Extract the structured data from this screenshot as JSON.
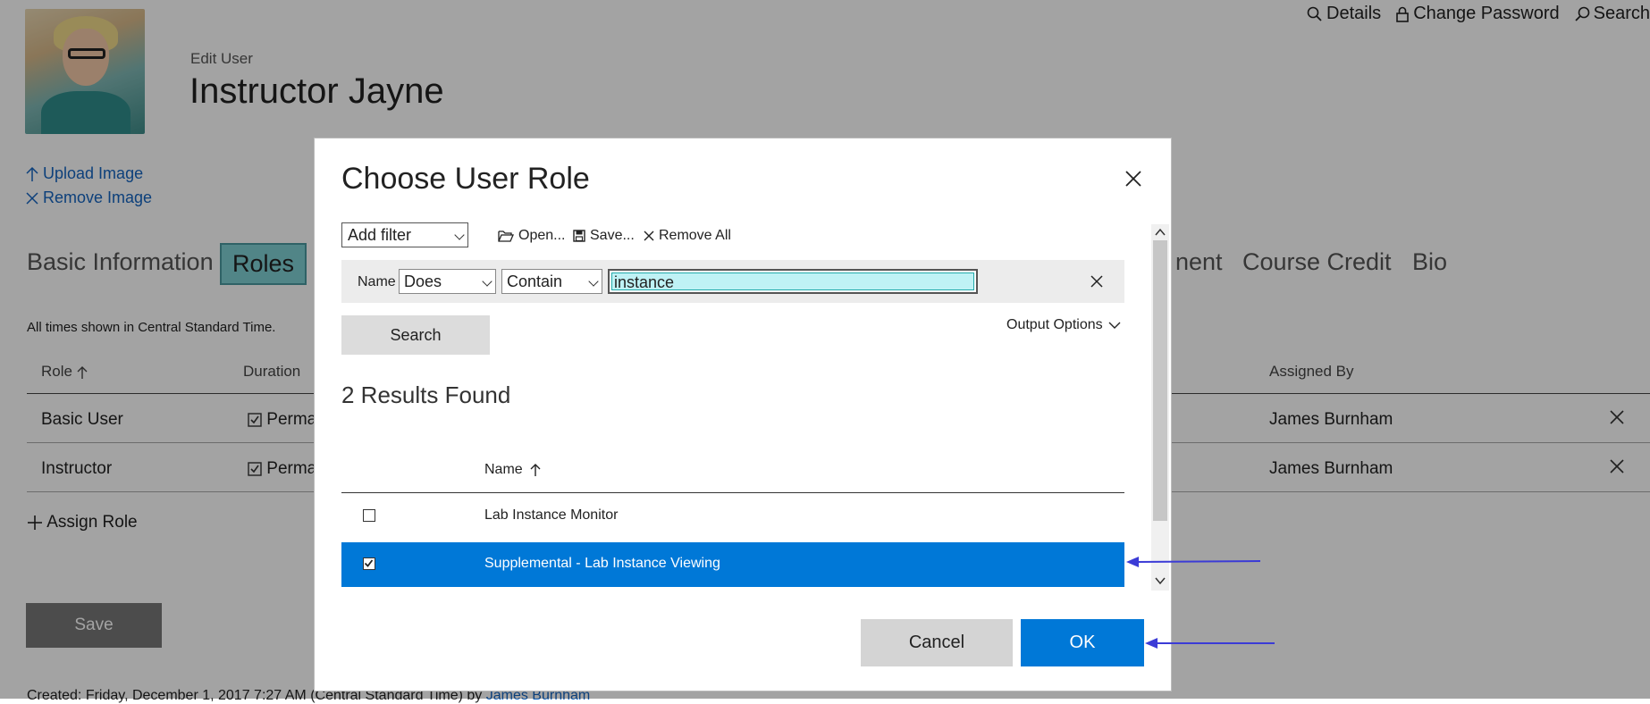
{
  "topnav": {
    "details": "Details",
    "change_password": "Change Password",
    "search": "Search"
  },
  "header": {
    "edit_label": "Edit User",
    "user_name": "Instructor Jayne"
  },
  "image_links": {
    "upload": "Upload Image",
    "remove": "Remove Image"
  },
  "tabs": [
    {
      "label": "Basic Information"
    },
    {
      "label": "Roles"
    },
    {
      "label": "nent"
    },
    {
      "label": "Course Credit"
    },
    {
      "label": "Bio"
    }
  ],
  "timezone_note": "All times shown in Central Standard Time.",
  "roles_table": {
    "headers": {
      "role": "Role",
      "duration": "Duration",
      "assigned_by": "Assigned By"
    },
    "rows": [
      {
        "role": "Basic User",
        "duration": "Perma",
        "assigned_by": "James Burnham"
      },
      {
        "role": "Instructor",
        "duration": "Perma",
        "assigned_by": "James Burnham"
      }
    ]
  },
  "assign_role": "Assign Role",
  "save_label": "Save",
  "created": {
    "prefix": "Created:   Friday, December 1, 2017 7:27 AM (Central Standard Time) by ",
    "by": "James Burnham"
  },
  "dialog": {
    "title": "Choose User Role",
    "add_filter": "Add filter",
    "open": "Open...",
    "save": "Save...",
    "remove_all": "Remove All",
    "filter": {
      "field": "Name",
      "operator1": "Does",
      "operator2": "Contain",
      "value": "instance"
    },
    "search_label": "Search",
    "output_options": "Output Options",
    "results_count": "2 Results Found",
    "column_name": "Name",
    "results": [
      {
        "name": "Lab Instance Monitor",
        "checked": false
      },
      {
        "name": "Supplemental - Lab Instance Viewing",
        "checked": true
      }
    ],
    "cancel": "Cancel",
    "ok": "OK"
  },
  "colors": {
    "accent": "#0078d7",
    "arrow": "#3b3bd6",
    "active_tab": "#7fd0d3"
  }
}
